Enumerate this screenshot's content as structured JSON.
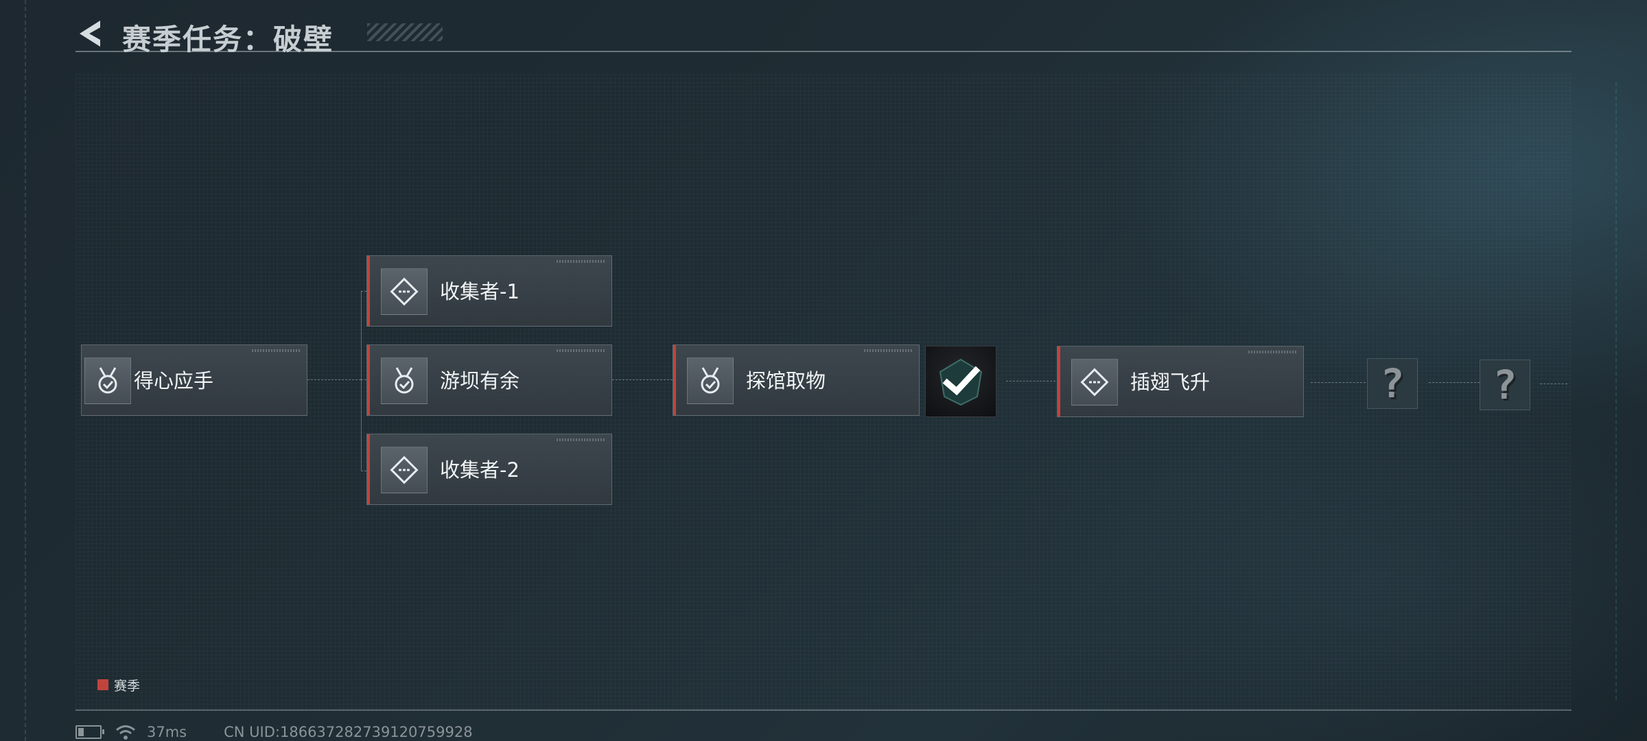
{
  "header": {
    "title": "赛季任务：破壁"
  },
  "tasks": [
    {
      "id": "t1",
      "label": "得心应手",
      "icon": "medal-check-icon",
      "season": false
    },
    {
      "id": "t2",
      "label": "收集者-1",
      "icon": "diamond-dash-icon",
      "season": true
    },
    {
      "id": "t3",
      "label": "游坝有余",
      "icon": "medal-check-icon",
      "season": true
    },
    {
      "id": "t4",
      "label": "收集者-2",
      "icon": "diamond-dash-icon",
      "season": true
    },
    {
      "id": "t5",
      "label": "探馆取物",
      "icon": "medal-check-icon",
      "season": true
    },
    {
      "id": "t6",
      "label": "插翅飞升",
      "icon": "diamond-dash-icon",
      "season": true
    }
  ],
  "reward": {
    "icon": "checkmark-badge-icon",
    "state": "completed"
  },
  "locked_nodes": [
    {
      "symbol": "?"
    },
    {
      "symbol": "?"
    }
  ],
  "legend": {
    "label": "赛季",
    "color": "#c0443c"
  },
  "status_bar": {
    "battery_level": 0.3,
    "latency": "37ms",
    "uid": "CN UID:18663728273912075​9928"
  },
  "colors": {
    "accent": "#c0443c",
    "background": "#1f2c33"
  }
}
